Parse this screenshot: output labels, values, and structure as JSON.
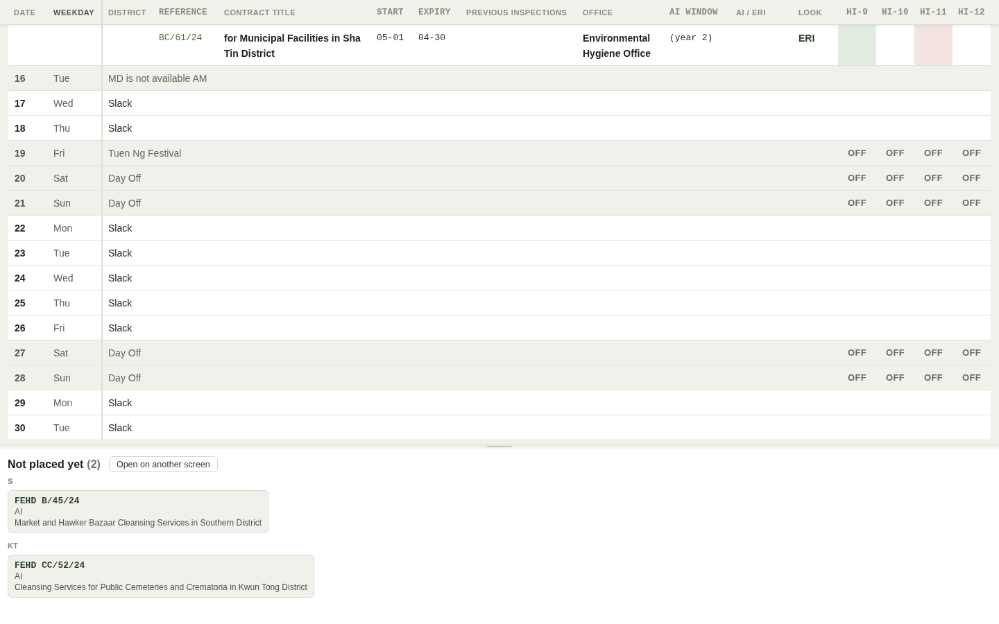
{
  "table": {
    "columns": [
      {
        "label": "DATE",
        "kind": "sans",
        "selected": false
      },
      {
        "label": "WEEKDAY",
        "kind": "sans",
        "selected": true
      },
      {
        "label": "DISTRICT",
        "kind": "sans",
        "selected": false
      },
      {
        "label": "REFERENCE",
        "kind": "mono",
        "selected": false
      },
      {
        "label": "CONTRACT TITLE",
        "kind": "sans",
        "selected": false
      },
      {
        "label": "START",
        "kind": "mono",
        "selected": false
      },
      {
        "label": "EXPIRY",
        "kind": "mono",
        "selected": false
      },
      {
        "label": "PREVIOUS INSPECTIONS",
        "kind": "sans",
        "selected": false
      },
      {
        "label": "OFFICE",
        "kind": "sans",
        "selected": false
      },
      {
        "label": "AI WINDOW",
        "kind": "mono",
        "selected": false
      },
      {
        "label": "AI / ERI",
        "kind": "sans",
        "selected": false
      },
      {
        "label": "LOOK",
        "kind": "sans",
        "selected": false
      },
      {
        "label": "HI-9",
        "kind": "mono",
        "selected": false
      },
      {
        "label": "HI-10",
        "kind": "mono",
        "selected": false
      },
      {
        "label": "HI-11",
        "kind": "mono",
        "selected": false
      },
      {
        "label": "HI-12",
        "kind": "mono",
        "selected": false
      }
    ],
    "contract_row": {
      "reference": "BC/61/24",
      "title": "for Municipal Facilities in Sha Tin District",
      "start": "05-01",
      "expiry": "04-30",
      "office": "Environmental Hygiene Office",
      "ai_window": "(year 2)",
      "look": "ERI",
      "inspectors": [
        {
          "kind": "pass"
        },
        {
          "kind": "empty"
        },
        {
          "kind": "fail"
        },
        {
          "kind": "empty"
        }
      ]
    },
    "day_rows": [
      {
        "date": "16",
        "weekday": "Tue",
        "kind": "blocked",
        "note": "MD is not available AM"
      },
      {
        "date": "17",
        "weekday": "Wed",
        "kind": "free",
        "note": "Slack"
      },
      {
        "date": "18",
        "weekday": "Thu",
        "kind": "free",
        "note": "Slack"
      },
      {
        "date": "19",
        "weekday": "Fri",
        "kind": "blocked",
        "note": "Tuen Ng Festival",
        "inspectors": [
          "OFF",
          "OFF",
          "OFF",
          "OFF"
        ]
      },
      {
        "date": "20",
        "weekday": "Sat",
        "kind": "blocked",
        "note": "Day Off",
        "inspectors": [
          "OFF",
          "OFF",
          "OFF",
          "OFF"
        ]
      },
      {
        "date": "21",
        "weekday": "Sun",
        "kind": "blocked",
        "note": "Day Off",
        "inspectors": [
          "OFF",
          "OFF",
          "OFF",
          "OFF"
        ]
      },
      {
        "date": "22",
        "weekday": "Mon",
        "kind": "free",
        "note": "Slack"
      },
      {
        "date": "23",
        "weekday": "Tue",
        "kind": "free",
        "note": "Slack"
      },
      {
        "date": "24",
        "weekday": "Wed",
        "kind": "free",
        "note": "Slack"
      },
      {
        "date": "25",
        "weekday": "Thu",
        "kind": "free",
        "note": "Slack"
      },
      {
        "date": "26",
        "weekday": "Fri",
        "kind": "free",
        "note": "Slack"
      },
      {
        "date": "27",
        "weekday": "Sat",
        "kind": "blocked",
        "note": "Day Off",
        "inspectors": [
          "OFF",
          "OFF",
          "OFF",
          "OFF"
        ]
      },
      {
        "date": "28",
        "weekday": "Sun",
        "kind": "blocked",
        "note": "Day Off",
        "inspectors": [
          "OFF",
          "OFF",
          "OFF",
          "OFF"
        ]
      },
      {
        "date": "29",
        "weekday": "Mon",
        "kind": "free",
        "note": "Slack"
      },
      {
        "date": "30",
        "weekday": "Tue",
        "kind": "free",
        "note": "Slack"
      }
    ]
  },
  "unplaced": {
    "title": "Not placed yet",
    "count": "(2)",
    "open_button": "Open on another screen",
    "groups": [
      {
        "district": "S",
        "items": [
          {
            "reference": "FEHD B/45/24",
            "type": "AI",
            "title": "Market and Hawker Bazaar Cleansing Services in Southern District"
          }
        ]
      },
      {
        "district": "KT",
        "items": [
          {
            "reference": "FEHD CC/52/24",
            "type": "AI",
            "title": "Cleansing Services for Public Cemeteries and Crematoria in Kwun Tong District"
          }
        ]
      }
    ]
  }
}
